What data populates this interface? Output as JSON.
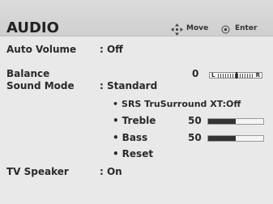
{
  "header": {
    "title": "AUDIO",
    "move_label": "Move",
    "enter_label": "Enter",
    "move_icon": "four-way-arrow-icon",
    "enter_icon": "enter-circle-icon"
  },
  "menu": {
    "auto_volume": {
      "label": "Auto Volume",
      "value": ": Off"
    },
    "balance": {
      "label": "Balance",
      "value": "0",
      "bar_left": "L",
      "bar_right": "R",
      "level": 0.5
    },
    "sound_mode": {
      "label": "Sound Mode",
      "value": ": Standard"
    },
    "srs": {
      "label": "SRS TruSurround XT:Off"
    },
    "treble": {
      "label": "Treble",
      "value": "50",
      "level": 0.5
    },
    "bass": {
      "label": "Bass",
      "value": "50",
      "level": 0.5
    },
    "reset": {
      "label": "Reset"
    },
    "tv_speaker": {
      "label": "TV Speaker",
      "value": ": On"
    }
  },
  "colors": {
    "background": "#e9e9e9",
    "header": "#d6d6d6",
    "text": "#2a2a2a",
    "bar_fill": "#333333"
  }
}
